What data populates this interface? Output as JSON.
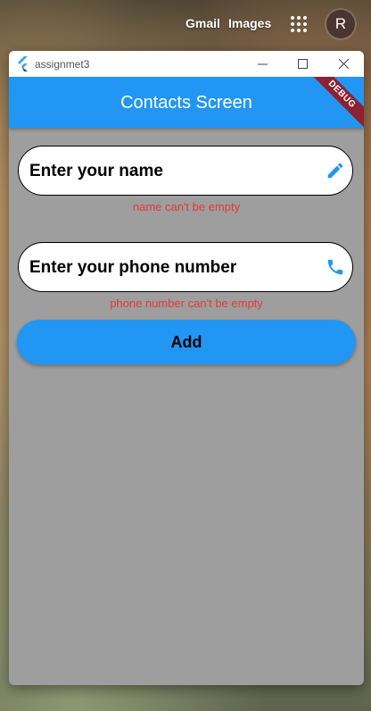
{
  "google_bar": {
    "gmail": "Gmail",
    "images": "Images",
    "avatar_letter": "R"
  },
  "window": {
    "app_name": "assignmet3"
  },
  "appbar": {
    "title": "Contacts Screen",
    "debug_banner": "DEBUG"
  },
  "form": {
    "name_placeholder": "Enter your name",
    "name_error": "name can't be empty",
    "phone_placeholder": "Enter your phone number",
    "phone_error": "phone number can't be empty",
    "add_label": "Add"
  },
  "icons": {
    "name_field": "edit-pencil-icon",
    "phone_field": "phone-icon"
  },
  "colors": {
    "primary": "#2196f3",
    "error": "#e53935",
    "body": "#9e9e9e"
  }
}
